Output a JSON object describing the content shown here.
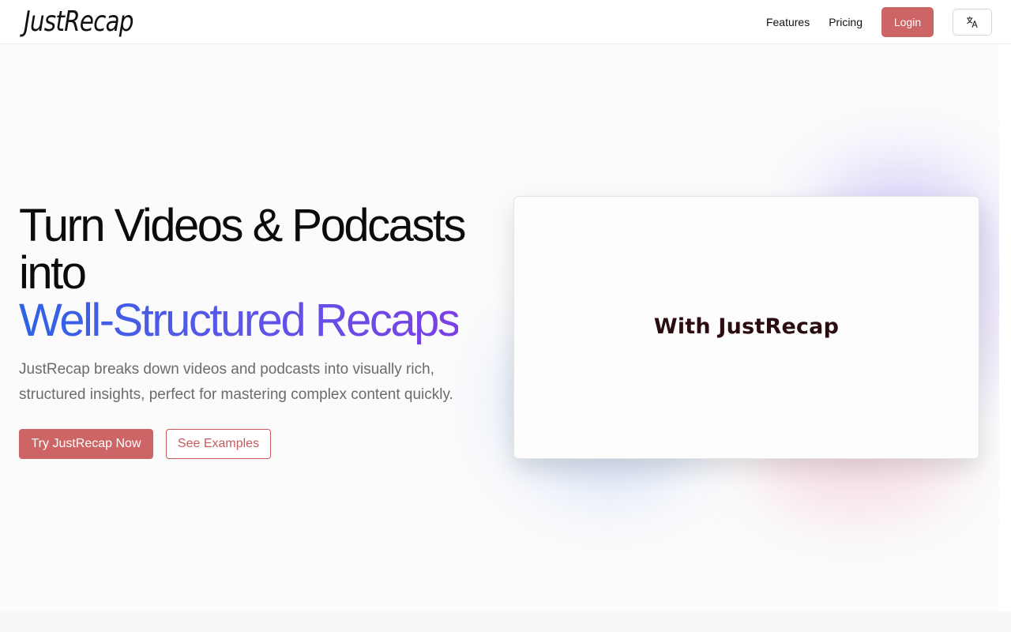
{
  "header": {
    "logo": "JustRecap",
    "nav": [
      {
        "label": "Features"
      },
      {
        "label": "Pricing"
      }
    ],
    "login_label": "Login",
    "language_icon": "translate-icon"
  },
  "hero": {
    "headline_line1": "Turn Videos & Podcasts",
    "headline_line2": "into",
    "headline_highlight": "Well-Structured Recaps",
    "subtext": "JustRecap breaks down videos and podcasts into visually rich, structured insights, perfect for mastering complex content quickly.",
    "primary_cta": "Try JustRecap Now",
    "secondary_cta": "See Examples",
    "card_text": "With JustRecap"
  },
  "colors": {
    "accent": "#cd6465",
    "gradient_start": "#2f62e6",
    "gradient_end": "#7a3fe6"
  }
}
